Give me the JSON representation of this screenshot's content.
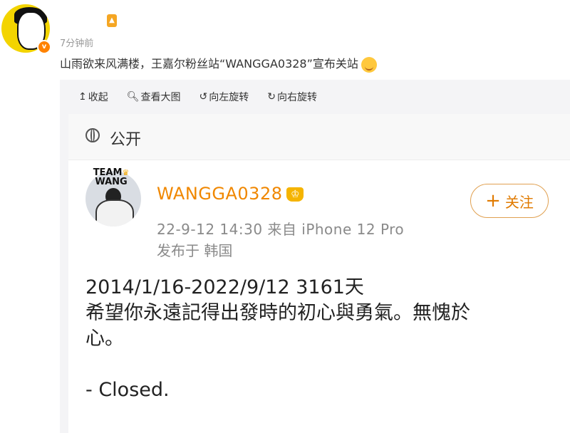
{
  "post": {
    "time": "7分钟前",
    "text": "山雨欲来风满楼，王嘉尔粉丝站“WANGGA0328”宣布关站"
  },
  "toolbar": {
    "collapse": "收起",
    "view_large": "查看大图",
    "rotate_left": "向左旋转",
    "rotate_right": "向右旋转"
  },
  "screenshot": {
    "visibility": "公开",
    "avatar_text_top": "TEAM",
    "avatar_text_bottom": "WANG",
    "username": "WANGGA0328",
    "meta": "22-9-12 14:30  来自 iPhone 12 Pro",
    "location": "发布于 韩国",
    "follow_label": "关注",
    "lines": [
      "2014/1/16-2022/9/12 3161天",
      "希望你永遠記得出發時的初心與勇氣。無愧於",
      "心。",
      "",
      "- Closed."
    ]
  },
  "colors": {
    "accent_orange": "#f08700",
    "avatar_yellow": "#f3d400",
    "meta_gray": "#8a8a8a"
  },
  "icons": [
    "verified-icon",
    "vip-icon",
    "smile-emoji",
    "collapse-icon",
    "search-icon",
    "rotate-left-icon",
    "rotate-right-icon",
    "globe-icon",
    "crown-icon",
    "plus-icon"
  ]
}
